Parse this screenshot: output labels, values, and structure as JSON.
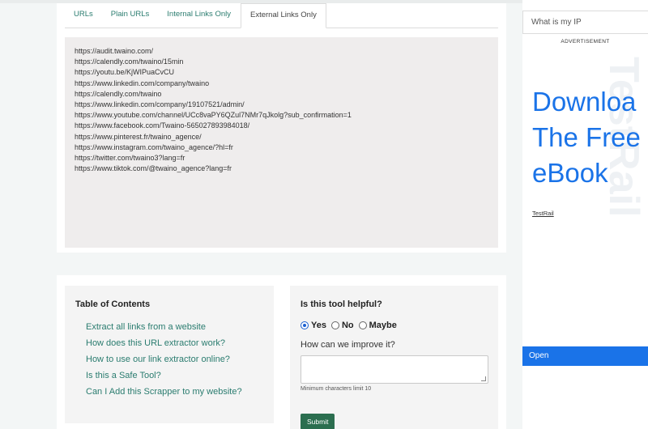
{
  "tabs": [
    {
      "label": "URLs",
      "active": false
    },
    {
      "label": "Plain URLs",
      "active": false
    },
    {
      "label": "Internal Links Only",
      "active": false
    },
    {
      "label": "External Links Only",
      "active": true
    }
  ],
  "output": {
    "lines": [
      "https://audit.twaino.com/",
      "https://calendly.com/twaino/15min",
      "https://youtu.be/KjWIPuaCvCU",
      "https://www.linkedin.com/company/twaino",
      "https://calendly.com/twaino",
      "https://www.linkedin.com/company/19107521/admin/",
      "https://www.youtube.com/channel/UCc8vaPY6QZul7NMr7qJkolg?sub_confirmation=1",
      "https://www.facebook.com/Twaino-565027893984018/",
      "https://www.pinterest.fr/twaino_agence/",
      "https://www.instagram.com/twaino_agence/?hl=fr",
      "https://twitter.com/twaino3?lang=fr",
      "https://www.tiktok.com/@twaino_agence?lang=fr"
    ]
  },
  "toc": {
    "title": "Table of Contents",
    "items": [
      "Extract all links from a website",
      "How does this URL extractor work?",
      "How to use our link extractor online?",
      "Is this a Safe Tool?",
      "Can I Add this Scrapper to my website?"
    ]
  },
  "feedback": {
    "title": "Is this tool helpful?",
    "options": [
      {
        "label": "Yes",
        "checked": true
      },
      {
        "label": "No",
        "checked": false
      },
      {
        "label": "Maybe",
        "checked": false
      }
    ],
    "question": "How can we improve it?",
    "hint": "Minimum characters limit 10",
    "submit_label": "Submit"
  },
  "sidebar": {
    "search_text": "What is my IP",
    "ad_label": "ADVERTISEMENT",
    "ad_watermark": "TestRail",
    "ad_headline_1": "Downloa",
    "ad_headline_2": "The Free",
    "ad_headline_3": "eBook",
    "ad_brand": "TestRail",
    "ad_button": "Open"
  },
  "colors": {
    "accent": "#2a7c6f",
    "submit": "#2b6e4f",
    "ad_blue": "#1a73e8",
    "page_bg": "#f3f6f6"
  }
}
